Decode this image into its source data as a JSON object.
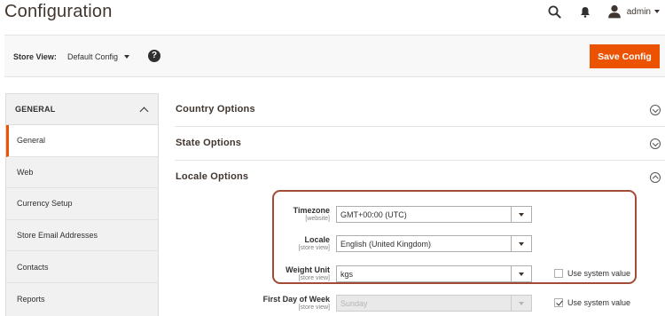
{
  "header": {
    "title": "Configuration",
    "user_name": "admin",
    "icons": [
      "search-icon",
      "bell-icon",
      "user-icon"
    ]
  },
  "store_bar": {
    "label": "Store View:",
    "selected": "Default Config",
    "help": "?",
    "save_label": "Save Config"
  },
  "sidebar": {
    "heading": "GENERAL",
    "items": [
      {
        "label": "General",
        "active": true
      },
      {
        "label": "Web"
      },
      {
        "label": "Currency Setup"
      },
      {
        "label": "Store Email Addresses"
      },
      {
        "label": "Contacts"
      },
      {
        "label": "Reports"
      }
    ]
  },
  "sections": {
    "country": "Country Options",
    "state": "State Options",
    "locale": "Locale Options"
  },
  "locale_fields": {
    "timezone": {
      "label": "Timezone",
      "scope": "[website]",
      "value": "GMT+00:00 (UTC)"
    },
    "locale": {
      "label": "Locale",
      "scope": "[store view]",
      "value": "English (United Kingdom)"
    },
    "weight_unit": {
      "label": "Weight Unit",
      "scope": "[store view]",
      "value": "kgs",
      "use_system_label": "Use system value",
      "use_system_checked": false
    },
    "first_day": {
      "label": "First Day of Week",
      "scope": "[store view]",
      "value": "Sunday",
      "use_system_label": "Use system value",
      "use_system_checked": true
    }
  },
  "colors": {
    "accent": "#eb5202",
    "highlight_border": "#a14c36",
    "text": "#303030"
  }
}
